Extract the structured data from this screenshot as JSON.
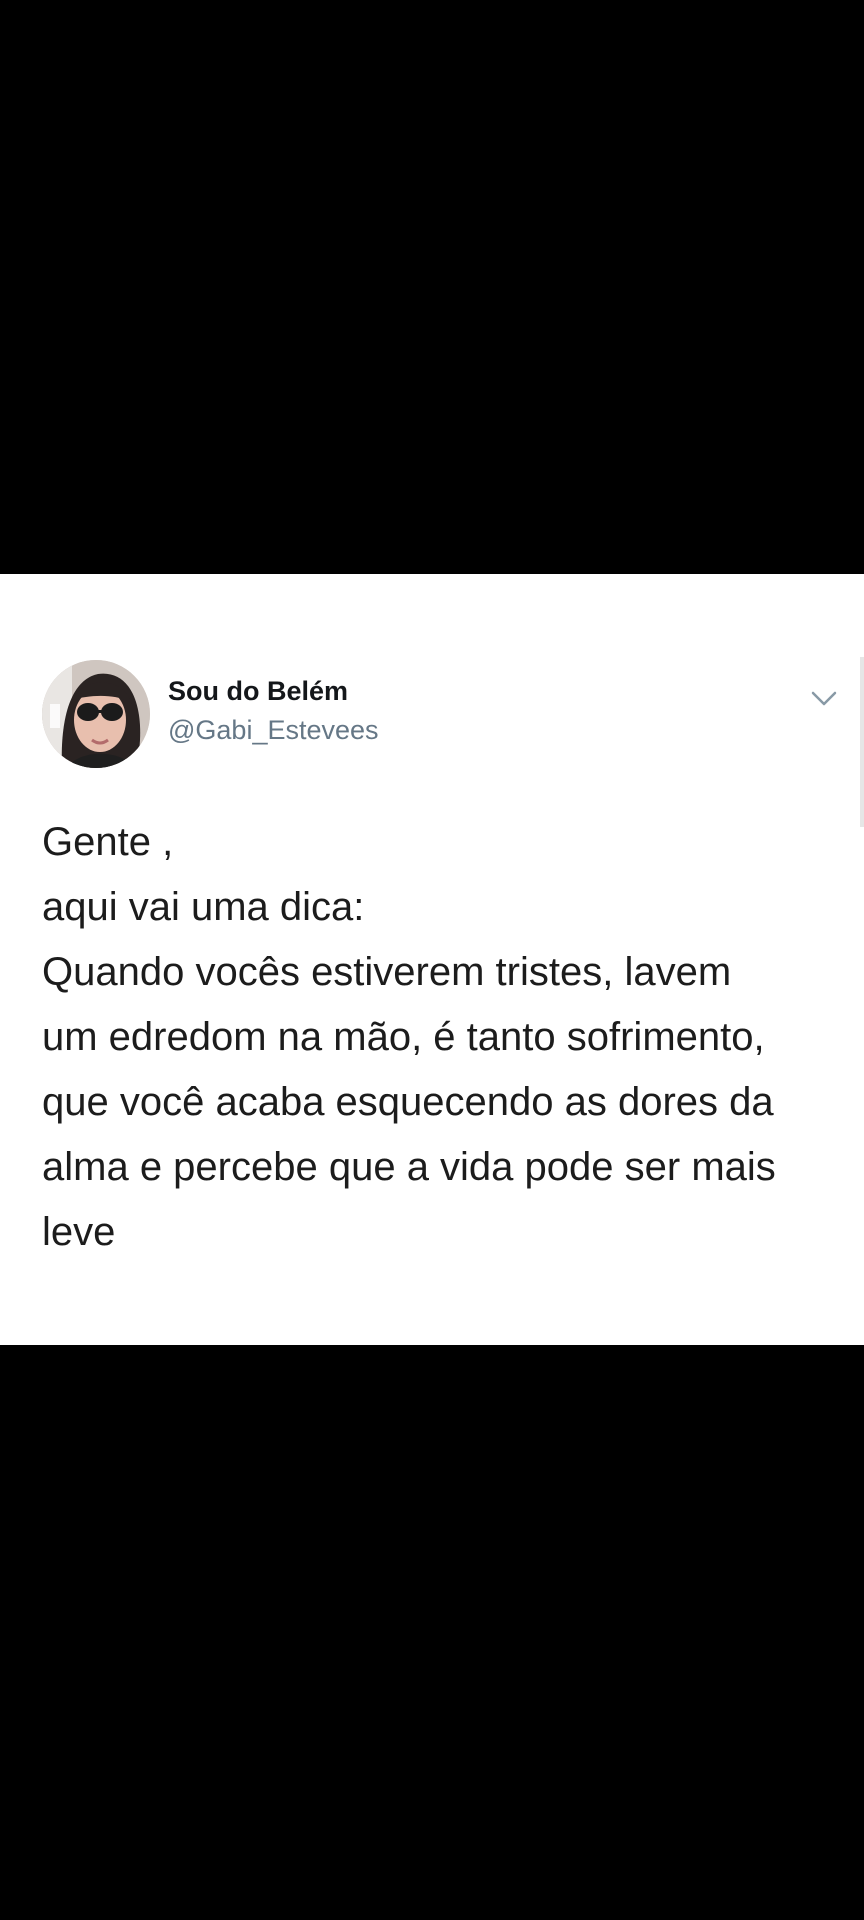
{
  "tweet": {
    "author": {
      "display_name": "Sou do Belém",
      "handle": "@Gabi_Estevees"
    },
    "text_lines": [
      "Gente ,",
      "aqui vai uma dica:",
      "Quando vocês estiverem tristes, lavem",
      "um edredom na mão, é tanto sofrimento,",
      "que você acaba esquecendo as dores da",
      "alma e percebe que a vida pode ser mais",
      "leve"
    ],
    "menu_icon": "chevron-down-icon"
  },
  "colors": {
    "background": "#000000",
    "card": "#ffffff",
    "name": "#14171a",
    "handle": "#657786",
    "text": "#1c1c1c"
  }
}
